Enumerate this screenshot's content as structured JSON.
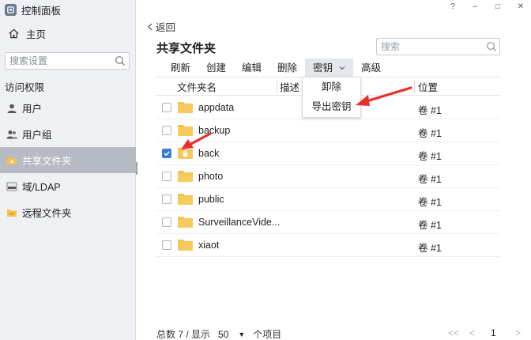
{
  "window": {
    "title": "控制面板",
    "controls": [
      "?",
      "‒",
      "□",
      "✕"
    ]
  },
  "sidebar": {
    "home_label": "主页",
    "search_placeholder": "搜索设置",
    "section_label": "访问权限",
    "items": [
      {
        "label": "用户",
        "icon": "user-icon"
      },
      {
        "label": "用户组",
        "icon": "group-icon"
      },
      {
        "label": "共享文件夹",
        "icon": "shared-folder-icon",
        "active": true
      },
      {
        "label": "域/LDAP",
        "icon": "ldap-icon"
      },
      {
        "label": "远程文件夹",
        "icon": "remote-folder-icon"
      }
    ]
  },
  "main": {
    "back_label": "返回",
    "title": "共享文件夹",
    "search_placeholder": "搜索",
    "toolbar": {
      "refresh": "刷新",
      "create": "创建",
      "edit": "编辑",
      "delete": "删除",
      "key": "密钥",
      "advanced": "高级"
    },
    "key_menu": [
      "卸除",
      "导出密钥"
    ],
    "columns": {
      "name": "文件夹名",
      "description": "描述",
      "location": "位置"
    },
    "rows": [
      {
        "name": "appdata",
        "location": "卷 #1",
        "checked": false,
        "locked": false
      },
      {
        "name": "backup",
        "location": "卷 #1",
        "checked": false,
        "locked": false
      },
      {
        "name": "back",
        "location": "卷 #1",
        "checked": true,
        "locked": true
      },
      {
        "name": "photo",
        "location": "卷 #1",
        "checked": false,
        "locked": false
      },
      {
        "name": "public",
        "location": "卷 #1",
        "checked": false,
        "locked": false
      },
      {
        "name": "SurveillanceVide...",
        "location": "卷 #1",
        "checked": false,
        "locked": false
      },
      {
        "name": "xiaot",
        "location": "卷 #1",
        "checked": false,
        "locked": false
      }
    ],
    "footer": {
      "total_text": "总数 7 / 显示",
      "page_size": "50",
      "items_text": "个项目",
      "first": "<<",
      "prev": "<",
      "page": "1",
      "next": ">"
    }
  },
  "colors": {
    "accent": "#3a7bd5",
    "folder": "#f5c250",
    "annotation_arrow": "#e8302a",
    "active_nav": "#b5bac3"
  }
}
